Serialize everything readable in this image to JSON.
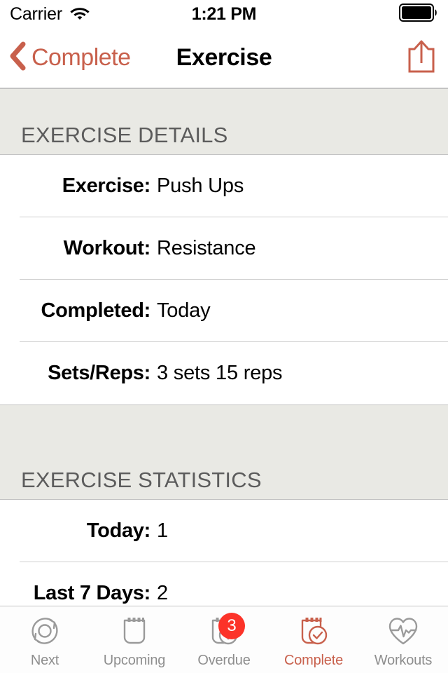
{
  "status_bar": {
    "carrier": "Carrier",
    "wifi_icon": "wifi-icon",
    "time": "1:21 PM",
    "battery_icon": "battery-full-icon"
  },
  "nav_bar": {
    "back_icon": "chevron-left-icon",
    "back_label": "Complete",
    "title": "Exercise",
    "share_icon": "share-icon"
  },
  "sections": [
    {
      "header": "EXERCISE DETAILS",
      "rows": [
        {
          "label": "Exercise:",
          "value": "Push Ups"
        },
        {
          "label": "Workout:",
          "value": "Resistance"
        },
        {
          "label": "Completed:",
          "value": "Today"
        },
        {
          "label": "Sets/Reps:",
          "value": "3 sets 15 reps"
        }
      ]
    },
    {
      "header": "EXERCISE STATISTICS",
      "rows": [
        {
          "label": "Today:",
          "value": "1"
        },
        {
          "label": "Last 7 Days:",
          "value": "2"
        }
      ]
    }
  ],
  "tab_bar": {
    "tabs": [
      {
        "label": "Next",
        "icon": "refresh-circle-icon",
        "active": false,
        "badge": null
      },
      {
        "label": "Upcoming",
        "icon": "notepad-icon",
        "active": false,
        "badge": null
      },
      {
        "label": "Overdue",
        "icon": "notepad-alert-icon",
        "active": false,
        "badge": "3"
      },
      {
        "label": "Complete",
        "icon": "notepad-check-icon",
        "active": true,
        "badge": null
      },
      {
        "label": "Workouts",
        "icon": "heart-pulse-icon",
        "active": false,
        "badge": null
      }
    ]
  },
  "colors": {
    "accent": "#c8604c",
    "inactive": "#8e8e8e",
    "badge": "#fc3329",
    "section_bg": "#e9e9e4",
    "separator": "#cfcfcf"
  }
}
